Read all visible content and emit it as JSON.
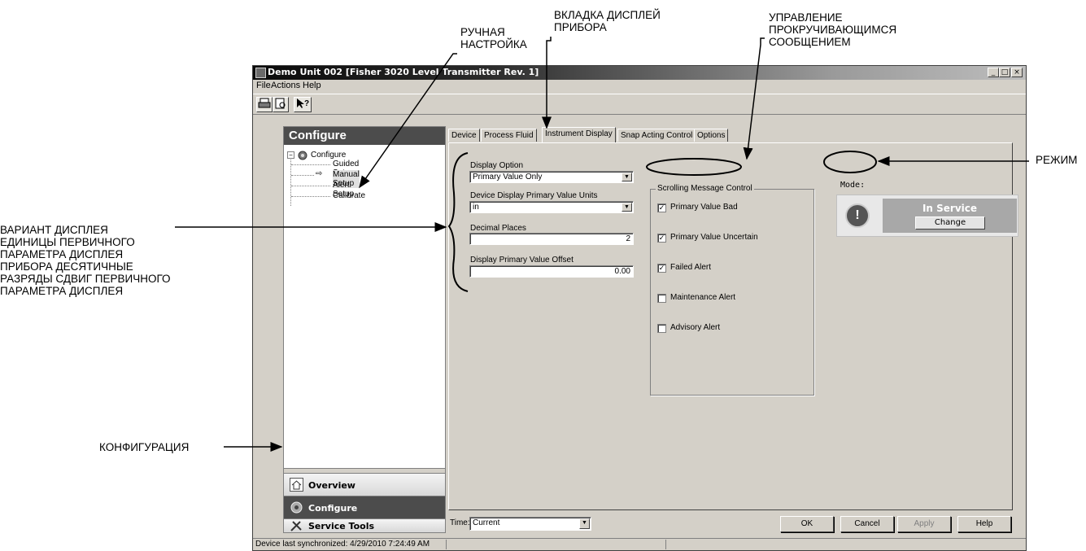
{
  "callouts": {
    "manual_setup": [
      "РУЧНАЯ",
      "НАСТРОЙКА"
    ],
    "instrument_display_tab": [
      "ВКЛАДКА ДИСПЛЕЙ",
      "ПРИБОРА"
    ],
    "scrolling_message": [
      "УПРАВЛЕНИЕ",
      "ПРОКРУЧИВАЮЩИМСЯ",
      "СООБЩЕНИЕМ"
    ],
    "mode": "РЕЖИМ",
    "display_fields": [
      "ВАРИАНТ ДИСПЛЕЯ",
      "ЕДИНИЦЫ ПЕРВИЧНОГО",
      "ПАРАМЕТРА ДИСПЛЕЯ",
      "ПРИБОРА ДЕСЯТИЧНЫЕ",
      "РАЗРЯДЫ СДВИГ ПЕРВИЧНОГО",
      "ПАРАМЕТРА ДИСПЛЕЯ"
    ],
    "configure": "КОНФИГУРАЦИЯ"
  },
  "window": {
    "title": "Demo Unit 002 [Fisher 3020 Level Transmitter Rev. 1]",
    "controls": [
      "_",
      "□",
      "×"
    ],
    "menu": [
      "File",
      "Actions",
      "Help"
    ],
    "toolbar_icons": [
      "print-icon",
      "print-preview-icon",
      "context-help-icon"
    ]
  },
  "left_pane": {
    "header": "Configure",
    "tree_root": "Configure",
    "tree_items": [
      "Guided Setup",
      "Manual Setup",
      "Alert Setup",
      "Calibrate"
    ],
    "nav": [
      "Overview",
      "Configure",
      "Service Tools"
    ]
  },
  "tabs": [
    "Device",
    "Process Fluid",
    "Instrument Display",
    "Snap Acting Control",
    "Options"
  ],
  "display": {
    "display_option_label": "Display Option",
    "display_option_value": "Primary Value Only",
    "units_label": "Device Display Primary Value Units",
    "units_value": "in",
    "decimal_label": "Decimal Places",
    "decimal_value": "2",
    "offset_label": "Display Primary Value Offset",
    "offset_value": "0.00"
  },
  "scrolling": {
    "title": "Scrolling Message Control",
    "items": [
      {
        "label": "Primary Value Bad",
        "checked": true
      },
      {
        "label": "Primary Value Uncertain",
        "checked": true
      },
      {
        "label": "Failed Alert",
        "checked": true
      },
      {
        "label": "Maintenance Alert",
        "checked": false
      },
      {
        "label": "Advisory Alert",
        "checked": false
      }
    ]
  },
  "mode": {
    "label": "Mode:",
    "status": "In Service",
    "change": "Change"
  },
  "bottom": {
    "time_label": "Time:",
    "time_value": "Current",
    "ok": "OK",
    "cancel": "Cancel",
    "apply": "Apply",
    "help": "Help"
  },
  "status": "Device last synchronized: 4/29/2010 7:24:49 AM"
}
